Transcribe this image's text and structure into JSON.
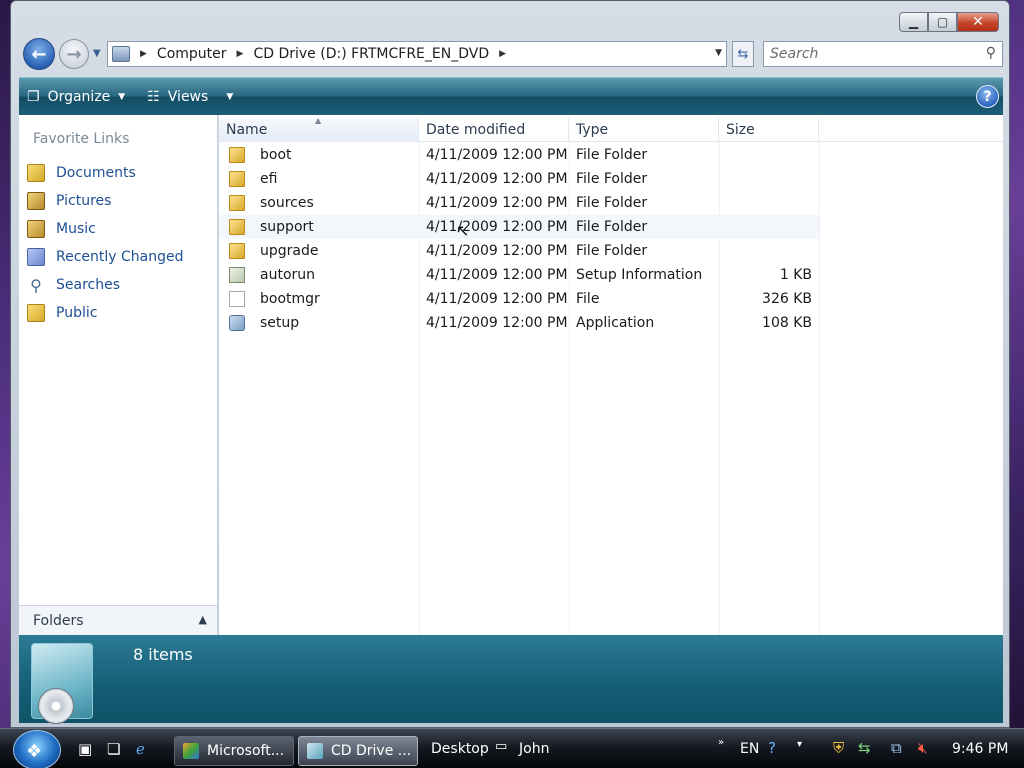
{
  "address": {
    "crumbs": [
      "Computer",
      "CD Drive (D:) FRTMCFRE_EN_DVD"
    ]
  },
  "search": {
    "placeholder": "Search"
  },
  "toolbar": {
    "organize_label": "Organize",
    "views_label": "Views"
  },
  "navpane": {
    "header": "Favorite Links",
    "links": [
      {
        "label": "Documents",
        "icon": "documents-icon"
      },
      {
        "label": "Pictures",
        "icon": "pictures-icon"
      },
      {
        "label": "Music",
        "icon": "music-icon"
      },
      {
        "label": "Recently Changed",
        "icon": "recently-changed-icon"
      },
      {
        "label": "Searches",
        "icon": "searches-icon"
      },
      {
        "label": "Public",
        "icon": "public-icon"
      }
    ],
    "folders_label": "Folders"
  },
  "columns": [
    "Name",
    "Date modified",
    "Type",
    "Size"
  ],
  "files": [
    {
      "name": "boot",
      "date": "4/11/2009 12:00 PM",
      "type": "File Folder",
      "size": "",
      "icon": "folder-icon"
    },
    {
      "name": "efi",
      "date": "4/11/2009 12:00 PM",
      "type": "File Folder",
      "size": "",
      "icon": "folder-icon"
    },
    {
      "name": "sources",
      "date": "4/11/2009 12:00 PM",
      "type": "File Folder",
      "size": "",
      "icon": "folder-icon"
    },
    {
      "name": "support",
      "date": "4/11/2009 12:00 PM",
      "type": "File Folder",
      "size": "",
      "icon": "folder-icon"
    },
    {
      "name": "upgrade",
      "date": "4/11/2009 12:00 PM",
      "type": "File Folder",
      "size": "",
      "icon": "folder-icon"
    },
    {
      "name": "autorun",
      "date": "4/11/2009 12:00 PM",
      "type": "Setup Information",
      "size": "1 KB",
      "icon": "setup-info-icon"
    },
    {
      "name": "bootmgr",
      "date": "4/11/2009 12:00 PM",
      "type": "File",
      "size": "326 KB",
      "icon": "file-icon"
    },
    {
      "name": "setup",
      "date": "4/11/2009 12:00 PM",
      "type": "Application",
      "size": "108 KB",
      "icon": "application-icon"
    }
  ],
  "details": {
    "items_count": "8 items"
  },
  "taskbar": {
    "tasks": [
      {
        "label": "Microsoft...",
        "icon": "windows-update-icon"
      },
      {
        "label": "CD Drive ...",
        "icon": "cd-drive-icon"
      }
    ],
    "desktop_label": "Desktop",
    "user_label": "John",
    "language": "EN",
    "clock": "9:46 PM"
  },
  "colors": {
    "toolbar": "#1d5e78",
    "details_pane": "#166078",
    "link_text": "#1f4f95"
  }
}
